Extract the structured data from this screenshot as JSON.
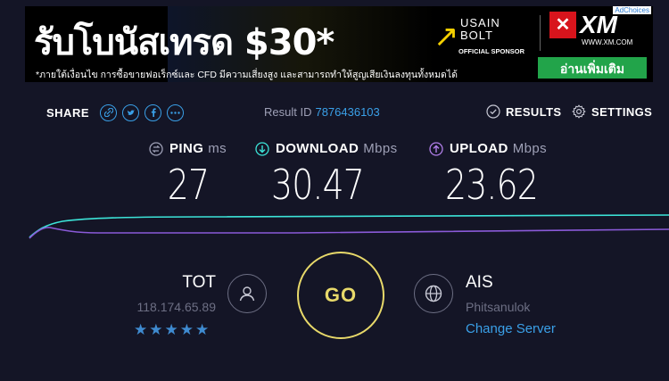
{
  "ad": {
    "headline": "รับโบนัสเทรด $30*",
    "disclaimer": "*ภายใต้เงื่อนไข การซื้อขายฟอเร็กซ์และ CFD มีความเสี่ยงสูง และสามารถทำให้สูญเสียเงินลงทุนทั้งหมดได้",
    "sponsor_name_line1": "USAIN",
    "sponsor_name_line2": "BOLT",
    "sponsor_caption": "OFFICIAL SPONSOR",
    "brand_logo": "XM",
    "brand_url": "WWW.XM.COM",
    "cta_label": "อ่านเพิ่มเติม",
    "adchoices_label": "AdChoices"
  },
  "header": {
    "share_label": "SHARE",
    "share_buttons": [
      "link-icon",
      "twitter-icon",
      "facebook-icon",
      "more-icon"
    ],
    "result_label": "Result ID",
    "result_id": "7876436103",
    "results_label": "RESULTS",
    "settings_label": "SETTINGS"
  },
  "metrics": {
    "ping": {
      "label": "PING",
      "unit": "ms",
      "value": "27",
      "color": "#9ea0b6"
    },
    "download": {
      "label": "DOWNLOAD",
      "unit": "Mbps",
      "value": "30.47",
      "color": "#3ce4d8"
    },
    "upload": {
      "label": "UPLOAD",
      "unit": "Mbps",
      "value": "23.62",
      "color": "#b07ee8"
    }
  },
  "isp": {
    "name": "TOT",
    "ip": "118.174.65.89",
    "stars": "★★★★★",
    "rating": 5
  },
  "go_label": "GO",
  "server": {
    "name": "AIS",
    "location": "Phitsanulok",
    "change_label": "Change Server"
  },
  "colors": {
    "background": "#141526",
    "accent": "#3aa0e8",
    "go": "#e8d96a",
    "download_line": "#3ce4d8",
    "upload_line": "#8a5ad8"
  }
}
